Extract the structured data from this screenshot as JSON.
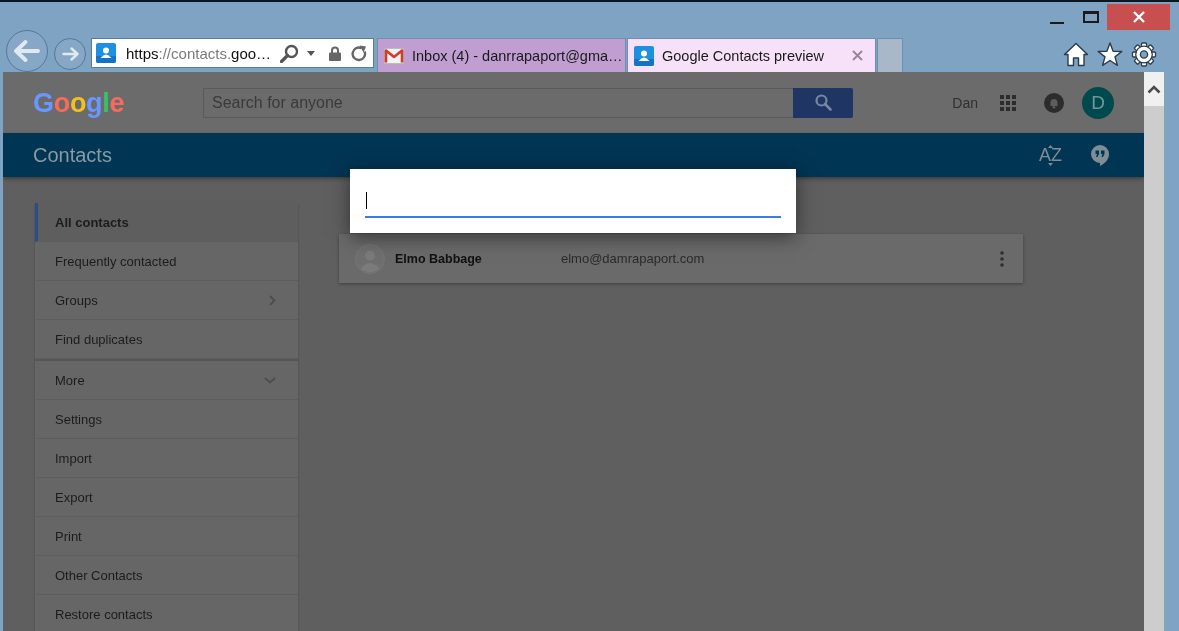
{
  "browser": {
    "address": {
      "parts": [
        {
          "text": "https",
          "dim": false
        },
        {
          "text": "://contacts.",
          "dim": true
        },
        {
          "text": "goo…",
          "dim": false
        }
      ]
    },
    "tabs": [
      {
        "title": "Inbox (4) - danrrapaport@gma…",
        "kind": "mail",
        "selected": false
      },
      {
        "title": "Google Contacts preview",
        "kind": "contacts",
        "selected": true
      }
    ]
  },
  "header": {
    "logo": "Google",
    "search": {
      "placeholder": "Search for anyone"
    },
    "user": {
      "name": "Dan",
      "initial": "D"
    }
  },
  "app_bar": {
    "title": "Contacts",
    "sort_label": "AZ"
  },
  "sidebar": {
    "sections": [
      {
        "items": [
          {
            "label": "All contacts",
            "kind": "item",
            "selected": true
          },
          {
            "label": "Frequently contacted",
            "kind": "item",
            "selected": false
          },
          {
            "label": "Groups",
            "kind": "submenu",
            "selected": false
          },
          {
            "label": "Find duplicates",
            "kind": "item",
            "selected": false
          }
        ]
      },
      {
        "items": [
          {
            "label": "More",
            "kind": "expander",
            "selected": false
          },
          {
            "label": "Settings",
            "kind": "item",
            "selected": false
          },
          {
            "label": "Import",
            "kind": "item",
            "selected": false
          },
          {
            "label": "Export",
            "kind": "item",
            "selected": false
          },
          {
            "label": "Print",
            "kind": "item",
            "selected": false
          },
          {
            "label": "Other Contacts",
            "kind": "item",
            "selected": false
          },
          {
            "label": "Restore contacts",
            "kind": "item",
            "selected": false
          }
        ]
      }
    ]
  },
  "contacts": [
    {
      "name": "Elmo Babbage",
      "email": "elmo@damrapaport.com"
    }
  ],
  "dialog": {
    "focused": true
  }
}
